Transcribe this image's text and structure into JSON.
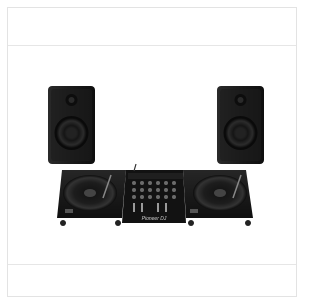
{
  "product": {
    "image_alt": "",
    "brand_text": "Pioneer DJ"
  },
  "colors": {
    "background": "#ffffff",
    "border": "#e3e3e3",
    "equipment": "#1b1b1b"
  }
}
